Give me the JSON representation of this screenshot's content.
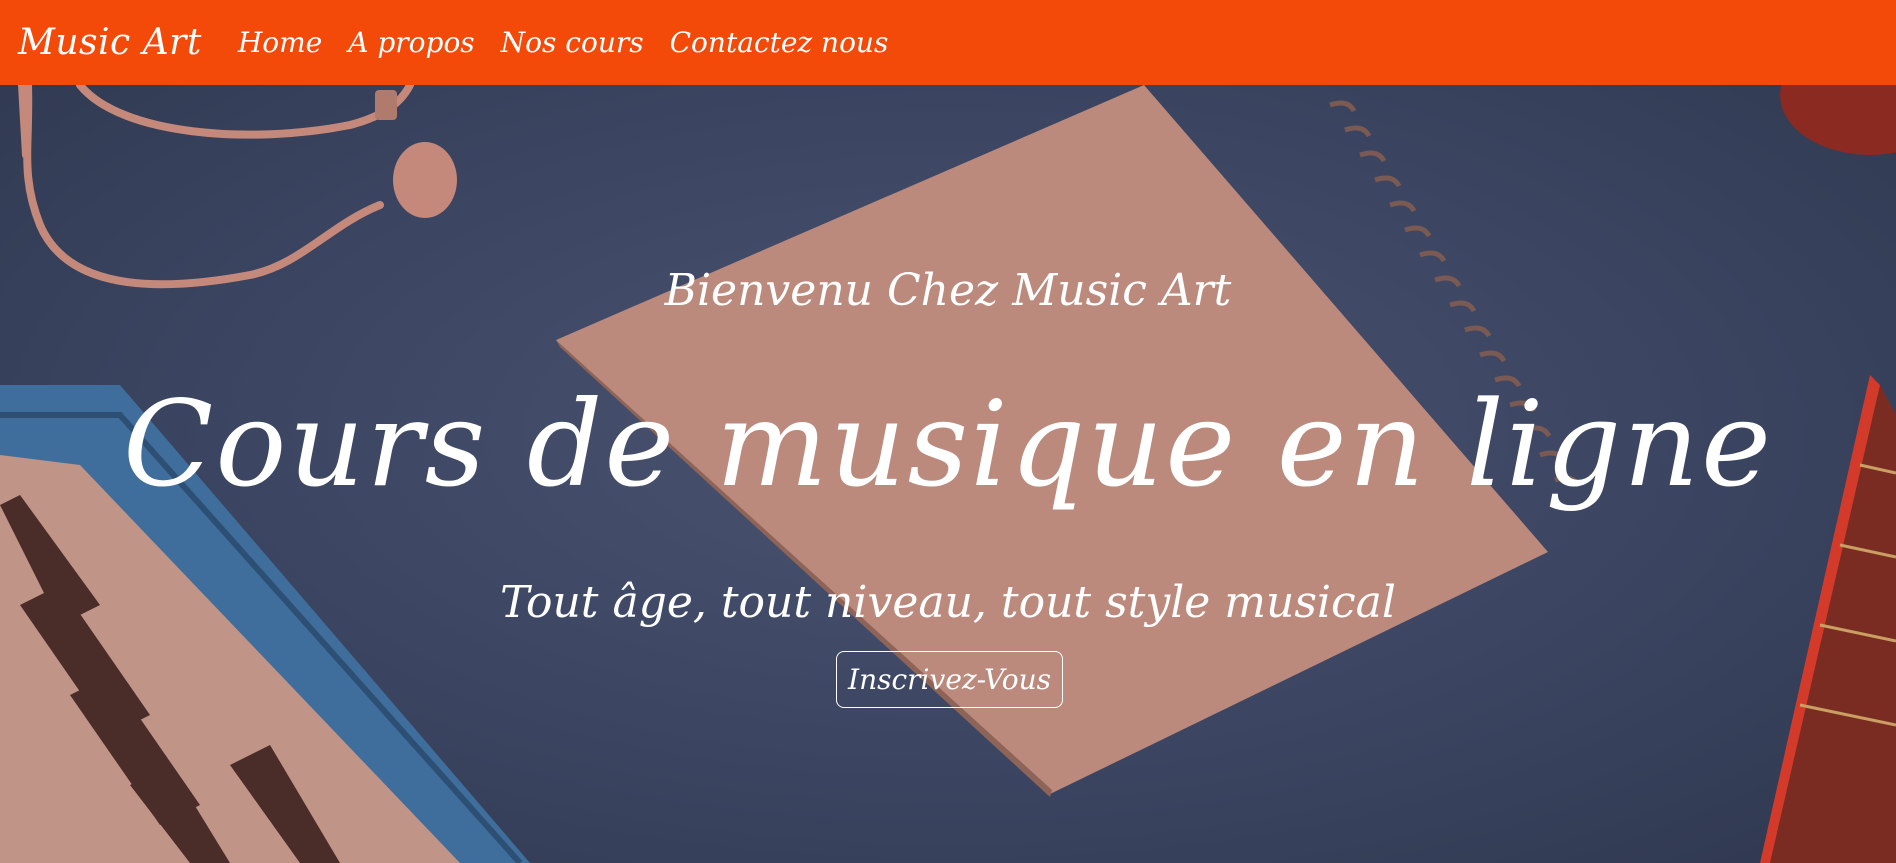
{
  "nav": {
    "brand": "Music Art",
    "links": [
      {
        "label": "Home"
      },
      {
        "label": "A propos"
      },
      {
        "label": "Nos cours"
      },
      {
        "label": "Contactez nous"
      }
    ]
  },
  "hero": {
    "welcome": "Bienvenu Chez Music Art",
    "headline": "Cours de musique en ligne",
    "tagline": "Tout âge, tout niveau, tout style musical",
    "cta_label": "Inscrivez-Vous"
  },
  "colors": {
    "navbar": "#f44a09",
    "hero_background": "#3b4561",
    "overlay_tint": "#c4897a",
    "text": "#ffffff"
  }
}
